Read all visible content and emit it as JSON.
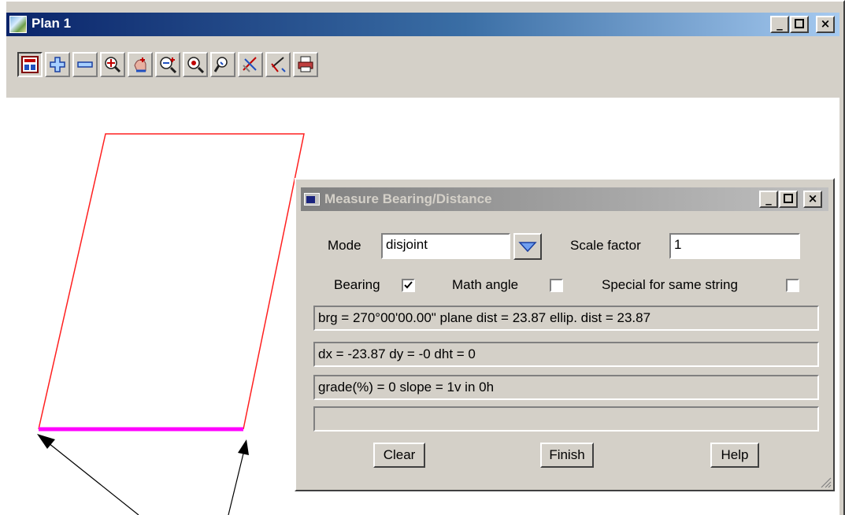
{
  "window": {
    "title": "Plan 1",
    "minimize": "_",
    "maximize": "□",
    "close": "×"
  },
  "toolbar": {
    "buttons": [
      {
        "icon": "plan-view-icon"
      },
      {
        "icon": "zoom-in-plus-icon"
      },
      {
        "icon": "zoom-out-minus-icon"
      },
      {
        "icon": "zoom-fit-icon"
      },
      {
        "icon": "pan-hand-icon"
      },
      {
        "icon": "zoom-dynamic-icon"
      },
      {
        "icon": "zoom-extents-icon"
      },
      {
        "icon": "zoom-previous-icon"
      },
      {
        "icon": "measure-icon"
      },
      {
        "icon": "pick-icon"
      },
      {
        "icon": "print-icon"
      }
    ]
  },
  "colors": {
    "string_outline": "#ff2020",
    "selected_segment": "#ff00ff",
    "title_active": "#0a246a",
    "dialog_title": "#808080"
  },
  "dialog": {
    "title": "Measure Bearing/Distance",
    "mode_label": "Mode",
    "mode_value": "disjoint",
    "scale_label": "Scale factor",
    "scale_value": "1",
    "bearing_label": "Bearing",
    "bearing_checked": true,
    "math_angle_label": "Math angle",
    "math_angle_checked": false,
    "special_label": "Special for same string",
    "special_checked": false,
    "readout_1": "brg = 270°00'00.00\" plane dist = 23.87  ellip. dist = 23.87",
    "readout_2": "dx = -23.87 dy = -0 dht = 0",
    "readout_3": "grade(%) = 0 slope = 1v in 0h",
    "readout_4": "",
    "clear_button": "Clear",
    "finish_button": "Finish",
    "help_button": "Help"
  }
}
